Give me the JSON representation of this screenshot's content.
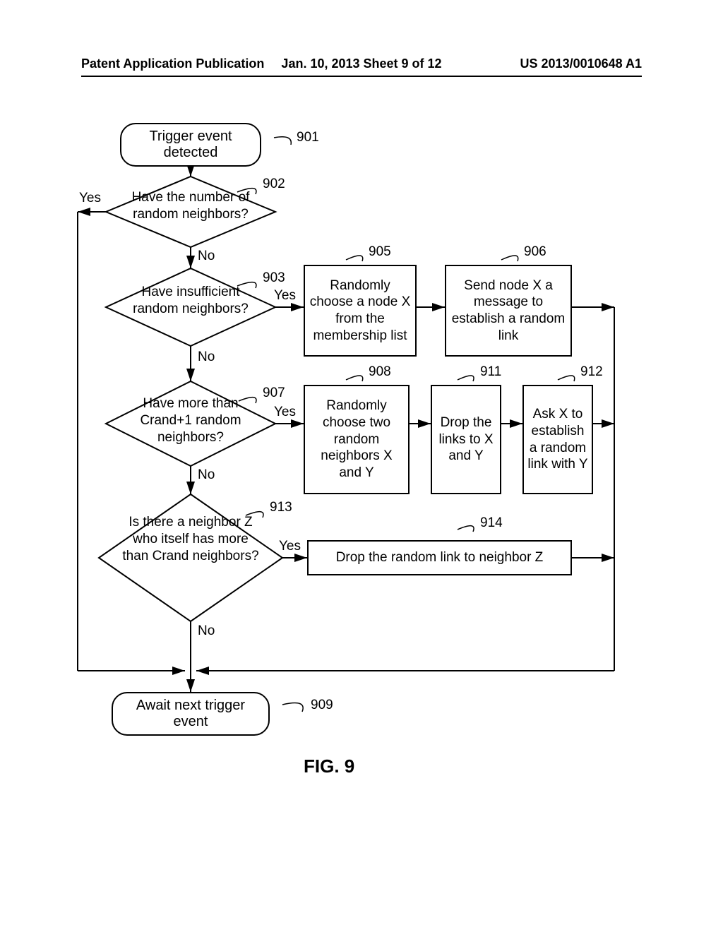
{
  "header": {
    "left": "Patent Application Publication",
    "mid": "Jan. 10, 2013  Sheet 9 of 12",
    "right": "US 2013/0010648 A1"
  },
  "figure_caption": "FIG. 9",
  "nodes": {
    "n901": {
      "ref": "901",
      "text": "Trigger event detected"
    },
    "n902": {
      "ref": "902",
      "text": "Have the number of random neighbors?"
    },
    "n903": {
      "ref": "903",
      "text": "Have insufficient random neighbors?"
    },
    "n905": {
      "ref": "905",
      "text": "Randomly choose a node X from the membership list"
    },
    "n906": {
      "ref": "906",
      "text": "Send node X a message to establish a random link"
    },
    "n907": {
      "ref": "907",
      "text": "Have more than Crand+1 random neighbors?"
    },
    "n908": {
      "ref": "908",
      "text": "Randomly choose two random neighbors X and Y"
    },
    "n911": {
      "ref": "911",
      "text": "Drop the links to X and Y"
    },
    "n912": {
      "ref": "912",
      "text": "Ask X to establish a random link with Y"
    },
    "n913": {
      "ref": "913",
      "text": "Is there a neighbor Z who itself has more than Crand neighbors?"
    },
    "n914": {
      "ref": "914",
      "text": "Drop the random link to neighbor Z"
    },
    "n909": {
      "ref": "909",
      "text": "Await next trigger event"
    }
  },
  "labels": {
    "yes": "Yes",
    "no": "No"
  },
  "chart_data": {
    "type": "flowchart",
    "title": "FIG. 9",
    "nodes": [
      {
        "id": "901",
        "shape": "terminator",
        "text": "Trigger event detected"
      },
      {
        "id": "902",
        "shape": "decision",
        "text": "Have the number of random neighbors?"
      },
      {
        "id": "903",
        "shape": "decision",
        "text": "Have insufficient random neighbors?"
      },
      {
        "id": "905",
        "shape": "process",
        "text": "Randomly choose a node X from the membership list"
      },
      {
        "id": "906",
        "shape": "process",
        "text": "Send node X a message to establish a random link"
      },
      {
        "id": "907",
        "shape": "decision",
        "text": "Have more than Crand+1 random neighbors?"
      },
      {
        "id": "908",
        "shape": "process",
        "text": "Randomly choose two random neighbors X and Y"
      },
      {
        "id": "911",
        "shape": "process",
        "text": "Drop the links to X and Y"
      },
      {
        "id": "912",
        "shape": "process",
        "text": "Ask X to establish a random link with Y"
      },
      {
        "id": "913",
        "shape": "decision",
        "text": "Is there a neighbor Z who itself has more than Crand neighbors?"
      },
      {
        "id": "914",
        "shape": "process",
        "text": "Drop the random link to neighbor Z"
      },
      {
        "id": "909",
        "shape": "terminator",
        "text": "Await next trigger event"
      }
    ],
    "edges": [
      {
        "from": "901",
        "to": "902",
        "label": ""
      },
      {
        "from": "902",
        "to": "909",
        "label": "Yes"
      },
      {
        "from": "902",
        "to": "903",
        "label": "No"
      },
      {
        "from": "903",
        "to": "905",
        "label": "Yes"
      },
      {
        "from": "903",
        "to": "907",
        "label": "No"
      },
      {
        "from": "905",
        "to": "906",
        "label": ""
      },
      {
        "from": "906",
        "to": "909",
        "label": ""
      },
      {
        "from": "907",
        "to": "908",
        "label": "Yes"
      },
      {
        "from": "907",
        "to": "913",
        "label": "No"
      },
      {
        "from": "908",
        "to": "911",
        "label": ""
      },
      {
        "from": "911",
        "to": "912",
        "label": ""
      },
      {
        "from": "912",
        "to": "909",
        "label": ""
      },
      {
        "from": "913",
        "to": "914",
        "label": "Yes"
      },
      {
        "from": "913",
        "to": "909",
        "label": "No"
      },
      {
        "from": "914",
        "to": "909",
        "label": ""
      }
    ]
  }
}
